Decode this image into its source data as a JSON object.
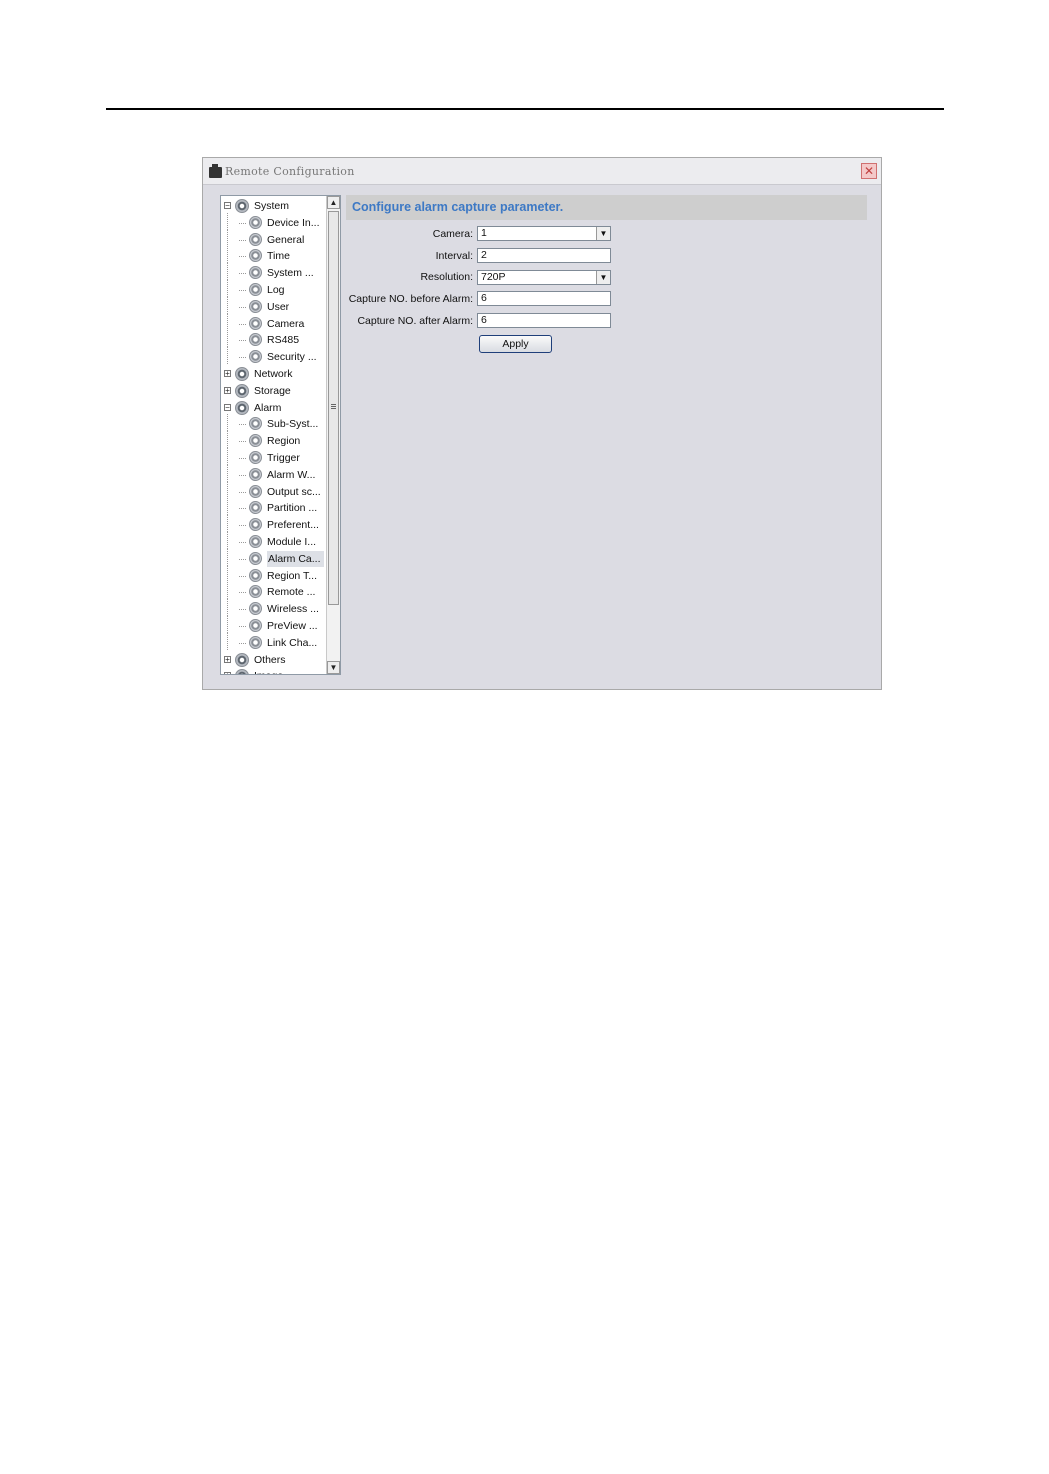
{
  "window": {
    "title": "Remote Configuration",
    "close_glyph": "✕"
  },
  "tree": {
    "nodes": [
      {
        "label": "System",
        "level": 0,
        "expander": "−"
      },
      {
        "label": "Device In...",
        "level": 1
      },
      {
        "label": "General",
        "level": 1
      },
      {
        "label": "Time",
        "level": 1
      },
      {
        "label": "System ...",
        "level": 1
      },
      {
        "label": "Log",
        "level": 1
      },
      {
        "label": "User",
        "level": 1
      },
      {
        "label": "Camera",
        "level": 1
      },
      {
        "label": "RS485",
        "level": 1
      },
      {
        "label": "Security ...",
        "level": 1
      },
      {
        "label": "Network",
        "level": 0,
        "expander": "+"
      },
      {
        "label": "Storage",
        "level": 0,
        "expander": "+"
      },
      {
        "label": "Alarm",
        "level": 0,
        "expander": "−"
      },
      {
        "label": "Sub-Syst...",
        "level": 1
      },
      {
        "label": "Region",
        "level": 1
      },
      {
        "label": "Trigger",
        "level": 1
      },
      {
        "label": "Alarm W...",
        "level": 1
      },
      {
        "label": "Output sc...",
        "level": 1
      },
      {
        "label": "Partition ...",
        "level": 1
      },
      {
        "label": "Preferent...",
        "level": 1
      },
      {
        "label": "Module I...",
        "level": 1
      },
      {
        "label": "Alarm Ca...",
        "level": 1,
        "selected": true
      },
      {
        "label": "Region T...",
        "level": 1
      },
      {
        "label": "Remote ...",
        "level": 1
      },
      {
        "label": "Wireless ...",
        "level": 1
      },
      {
        "label": "PreView ...",
        "level": 1
      },
      {
        "label": "Link Cha...",
        "level": 1
      },
      {
        "label": "Others",
        "level": 0,
        "expander": "+"
      },
      {
        "label": "Image",
        "level": 0,
        "expander": "+"
      }
    ],
    "scroll_up": "▲",
    "scroll_down": "▼"
  },
  "panel": {
    "header": "Configure alarm capture parameter.",
    "camera_label": "Camera:",
    "camera_value": "1",
    "interval_label": "Interval:",
    "interval_value": "2",
    "resolution_label": "Resolution:",
    "resolution_value": "720P",
    "before_label": "Capture NO. before Alarm:",
    "before_value": "6",
    "after_label": "Capture NO. after Alarm:",
    "after_value": "6",
    "apply_label": "Apply",
    "dropdown_glyph": "▼"
  },
  "icons": [
    "app-icon",
    "close-icon",
    "gear-icon",
    "expand-icon",
    "collapse-icon",
    "scroll-up-icon",
    "scroll-down-icon",
    "dropdown-arrow-icon"
  ]
}
